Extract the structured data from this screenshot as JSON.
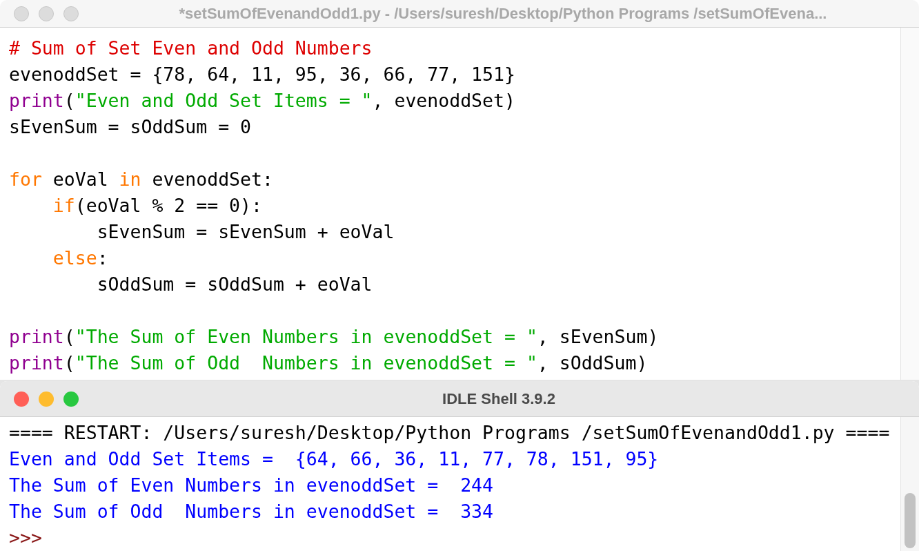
{
  "editor": {
    "title": "*setSumOfEvenandOdd1.py - /Users/suresh/Desktop/Python Programs /setSumOfEvena...",
    "active": false,
    "lines": [
      {
        "kind": "code",
        "tokens": [
          {
            "kind": "comment",
            "text": "# Sum of Set Even and Odd Numbers"
          }
        ]
      },
      {
        "kind": "code",
        "tokens": [
          {
            "kind": "plain",
            "text": "evenoddSet = {78, 64, 11, 95, 36, 66, 77, 151}"
          }
        ]
      },
      {
        "kind": "code",
        "tokens": [
          {
            "kind": "builtin",
            "text": "print"
          },
          {
            "kind": "plain",
            "text": "("
          },
          {
            "kind": "string",
            "text": "\"Even and Odd Set Items = \""
          },
          {
            "kind": "plain",
            "text": ", evenoddSet)"
          }
        ]
      },
      {
        "kind": "code",
        "tokens": [
          {
            "kind": "plain",
            "text": "sEvenSum = sOddSum = 0"
          }
        ]
      },
      {
        "kind": "blank"
      },
      {
        "kind": "code",
        "tokens": [
          {
            "kind": "keyword",
            "text": "for"
          },
          {
            "kind": "plain",
            "text": " eoVal "
          },
          {
            "kind": "keyword",
            "text": "in"
          },
          {
            "kind": "plain",
            "text": " evenoddSet:"
          }
        ]
      },
      {
        "kind": "code",
        "tokens": [
          {
            "kind": "keyword",
            "text": "    if"
          },
          {
            "kind": "plain",
            "text": "(eoVal % 2 == 0):"
          }
        ]
      },
      {
        "kind": "code",
        "tokens": [
          {
            "kind": "plain",
            "text": "        sEvenSum = sEvenSum + eoVal"
          }
        ]
      },
      {
        "kind": "code",
        "tokens": [
          {
            "kind": "keyword",
            "text": "    else"
          },
          {
            "kind": "plain",
            "text": ":"
          }
        ]
      },
      {
        "kind": "code",
        "tokens": [
          {
            "kind": "plain",
            "text": "        sOddSum = sOddSum + eoVal"
          }
        ]
      },
      {
        "kind": "blank"
      },
      {
        "kind": "code",
        "tokens": [
          {
            "kind": "builtin",
            "text": "print"
          },
          {
            "kind": "plain",
            "text": "("
          },
          {
            "kind": "string",
            "text": "\"The Sum of Even Numbers in evenoddSet = \""
          },
          {
            "kind": "plain",
            "text": ", sEvenSum)"
          }
        ]
      },
      {
        "kind": "code",
        "tokens": [
          {
            "kind": "builtin",
            "text": "print"
          },
          {
            "kind": "plain",
            "text": "("
          },
          {
            "kind": "string",
            "text": "\"The Sum of Odd  Numbers in evenoddSet = \""
          },
          {
            "kind": "plain",
            "text": ", sOddSum)"
          }
        ]
      }
    ]
  },
  "shell": {
    "title": "IDLE Shell 3.9.2",
    "active": true,
    "lines": [
      {
        "kind": "restart",
        "text": "==== RESTART: /Users/suresh/Desktop/Python Programs /setSumOfEvenandOdd1.py ===="
      },
      {
        "kind": "output",
        "text": "Even and Odd Set Items =  {64, 66, 36, 11, 77, 78, 151, 95}"
      },
      {
        "kind": "output",
        "text": "The Sum of Even Numbers in evenoddSet =  244"
      },
      {
        "kind": "output",
        "text": "The Sum of Odd  Numbers in evenoddSet =  334"
      },
      {
        "kind": "prompt",
        "text": ">>>"
      }
    ]
  }
}
